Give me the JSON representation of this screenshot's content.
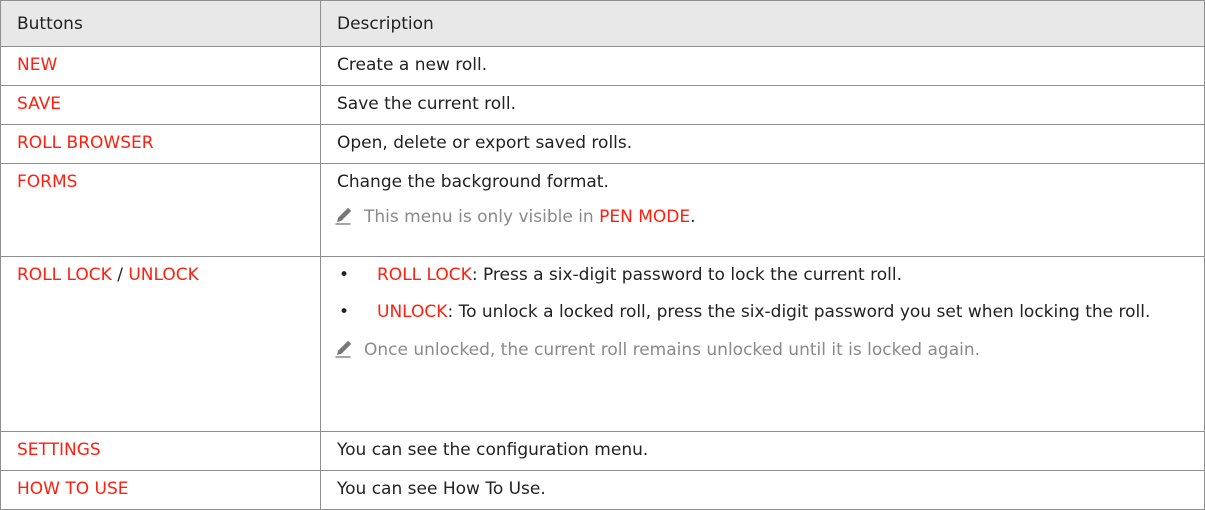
{
  "table": {
    "headers": {
      "col1": "Buttons",
      "col2": "Description"
    },
    "rows": [
      {
        "button": "NEW",
        "description": "Create a new roll."
      },
      {
        "button": "SAVE",
        "description": "Save the current roll."
      },
      {
        "button": "ROLL BROWSER",
        "description": "Open, delete or export saved rolls."
      },
      {
        "button": "FORMS",
        "description": "Change the background format.",
        "note": {
          "icon": "pencil-icon",
          "text_before": "This menu is only visible in ",
          "highlight": "PEN MODE",
          "text_after": "."
        }
      },
      {
        "button_part1": "ROLL LOCK",
        "separator": " / ",
        "button_part2": "UNLOCK",
        "bullets": [
          {
            "term": "ROLL LOCK",
            "text": ": Press a six-digit password to lock the current roll."
          },
          {
            "term": "UNLOCK",
            "text": ": To unlock a locked roll, press the six-digit password you set when locking the roll."
          }
        ],
        "note": {
          "icon": "pencil-icon",
          "text": "Once unlocked, the current roll remains unlocked until it is locked again."
        }
      },
      {
        "button": "SETTINGS",
        "description": "You can see the configuration menu."
      },
      {
        "button": "HOW TO USE",
        "description": "You can see How To Use."
      }
    ]
  },
  "colors": {
    "accent": "#ff1f0f",
    "text": "#222222",
    "note": "#8a8a8a",
    "header_bg": "#e8e8e8",
    "border": "#8f8f8f"
  }
}
